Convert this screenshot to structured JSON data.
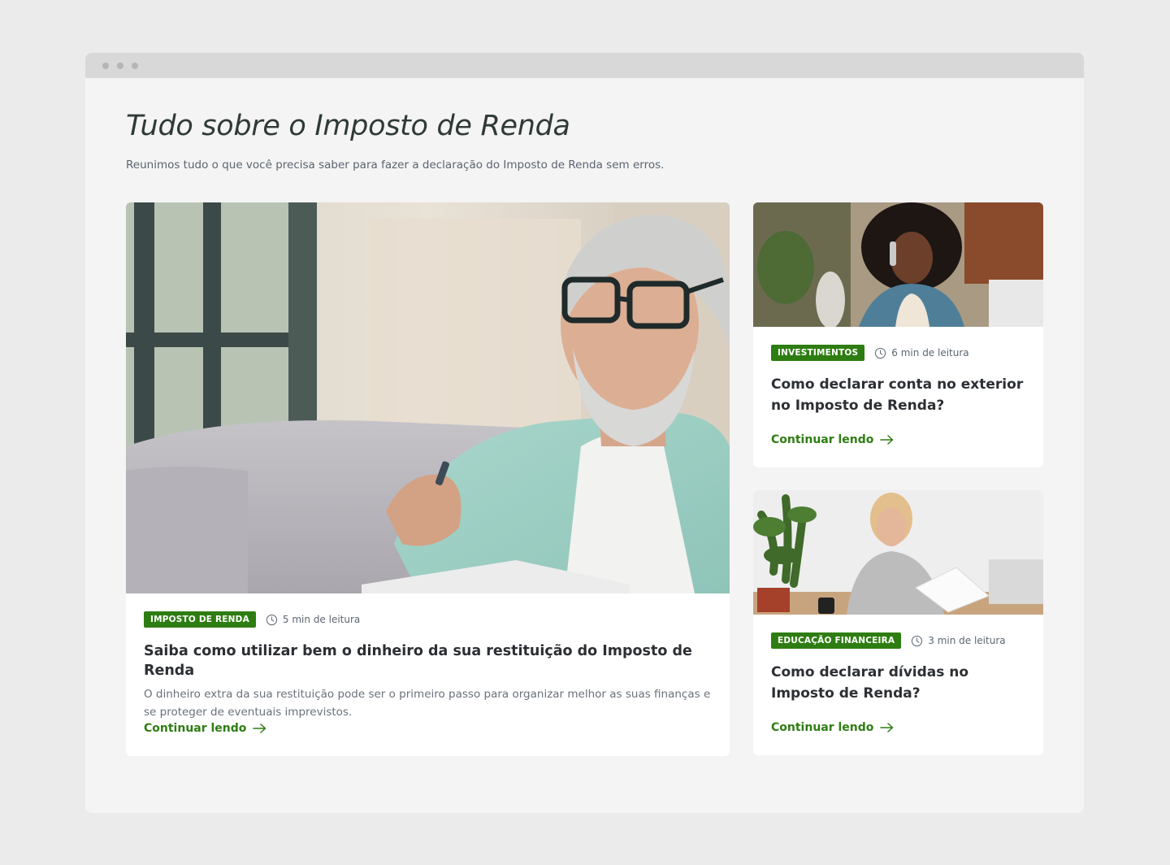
{
  "page": {
    "title": "Tudo sobre o Imposto de Renda",
    "subtitle": "Reunimos tudo o que você precisa saber para fazer a declaração do Imposto de Renda sem erros."
  },
  "colors": {
    "accent": "#2e7d12",
    "background": "#ebebeb",
    "panel": "#f4f4f4"
  },
  "articles": [
    {
      "category": "IMPOSTO DE RENDA",
      "read_time": "5 min de leitura",
      "title": "Saiba como utilizar bem o dinheiro da sua restituição do Imposto de Renda",
      "excerpt": "O dinheiro extra da sua restituição pode ser o primeiro passo para organizar melhor as suas finanças e se proteger de eventuais imprevistos.",
      "cta": "Continuar lendo",
      "image": "man-with-glasses-reading-papers"
    },
    {
      "category": "INVESTIMENTOS",
      "read_time": "6 min de leitura",
      "title": "Como declarar conta no exterior no Imposto de Renda?",
      "cta": "Continuar lendo",
      "image": "woman-on-phone"
    },
    {
      "category": "EDUCAÇÃO FINANCEIRA",
      "read_time": "3 min de leitura",
      "title": "Como declarar dívidas no Imposto de Renda?",
      "cta": "Continuar lendo",
      "image": "woman-reading-documents"
    }
  ],
  "icons": {
    "clock": "clock-icon",
    "arrow": "arrow-right-icon"
  }
}
